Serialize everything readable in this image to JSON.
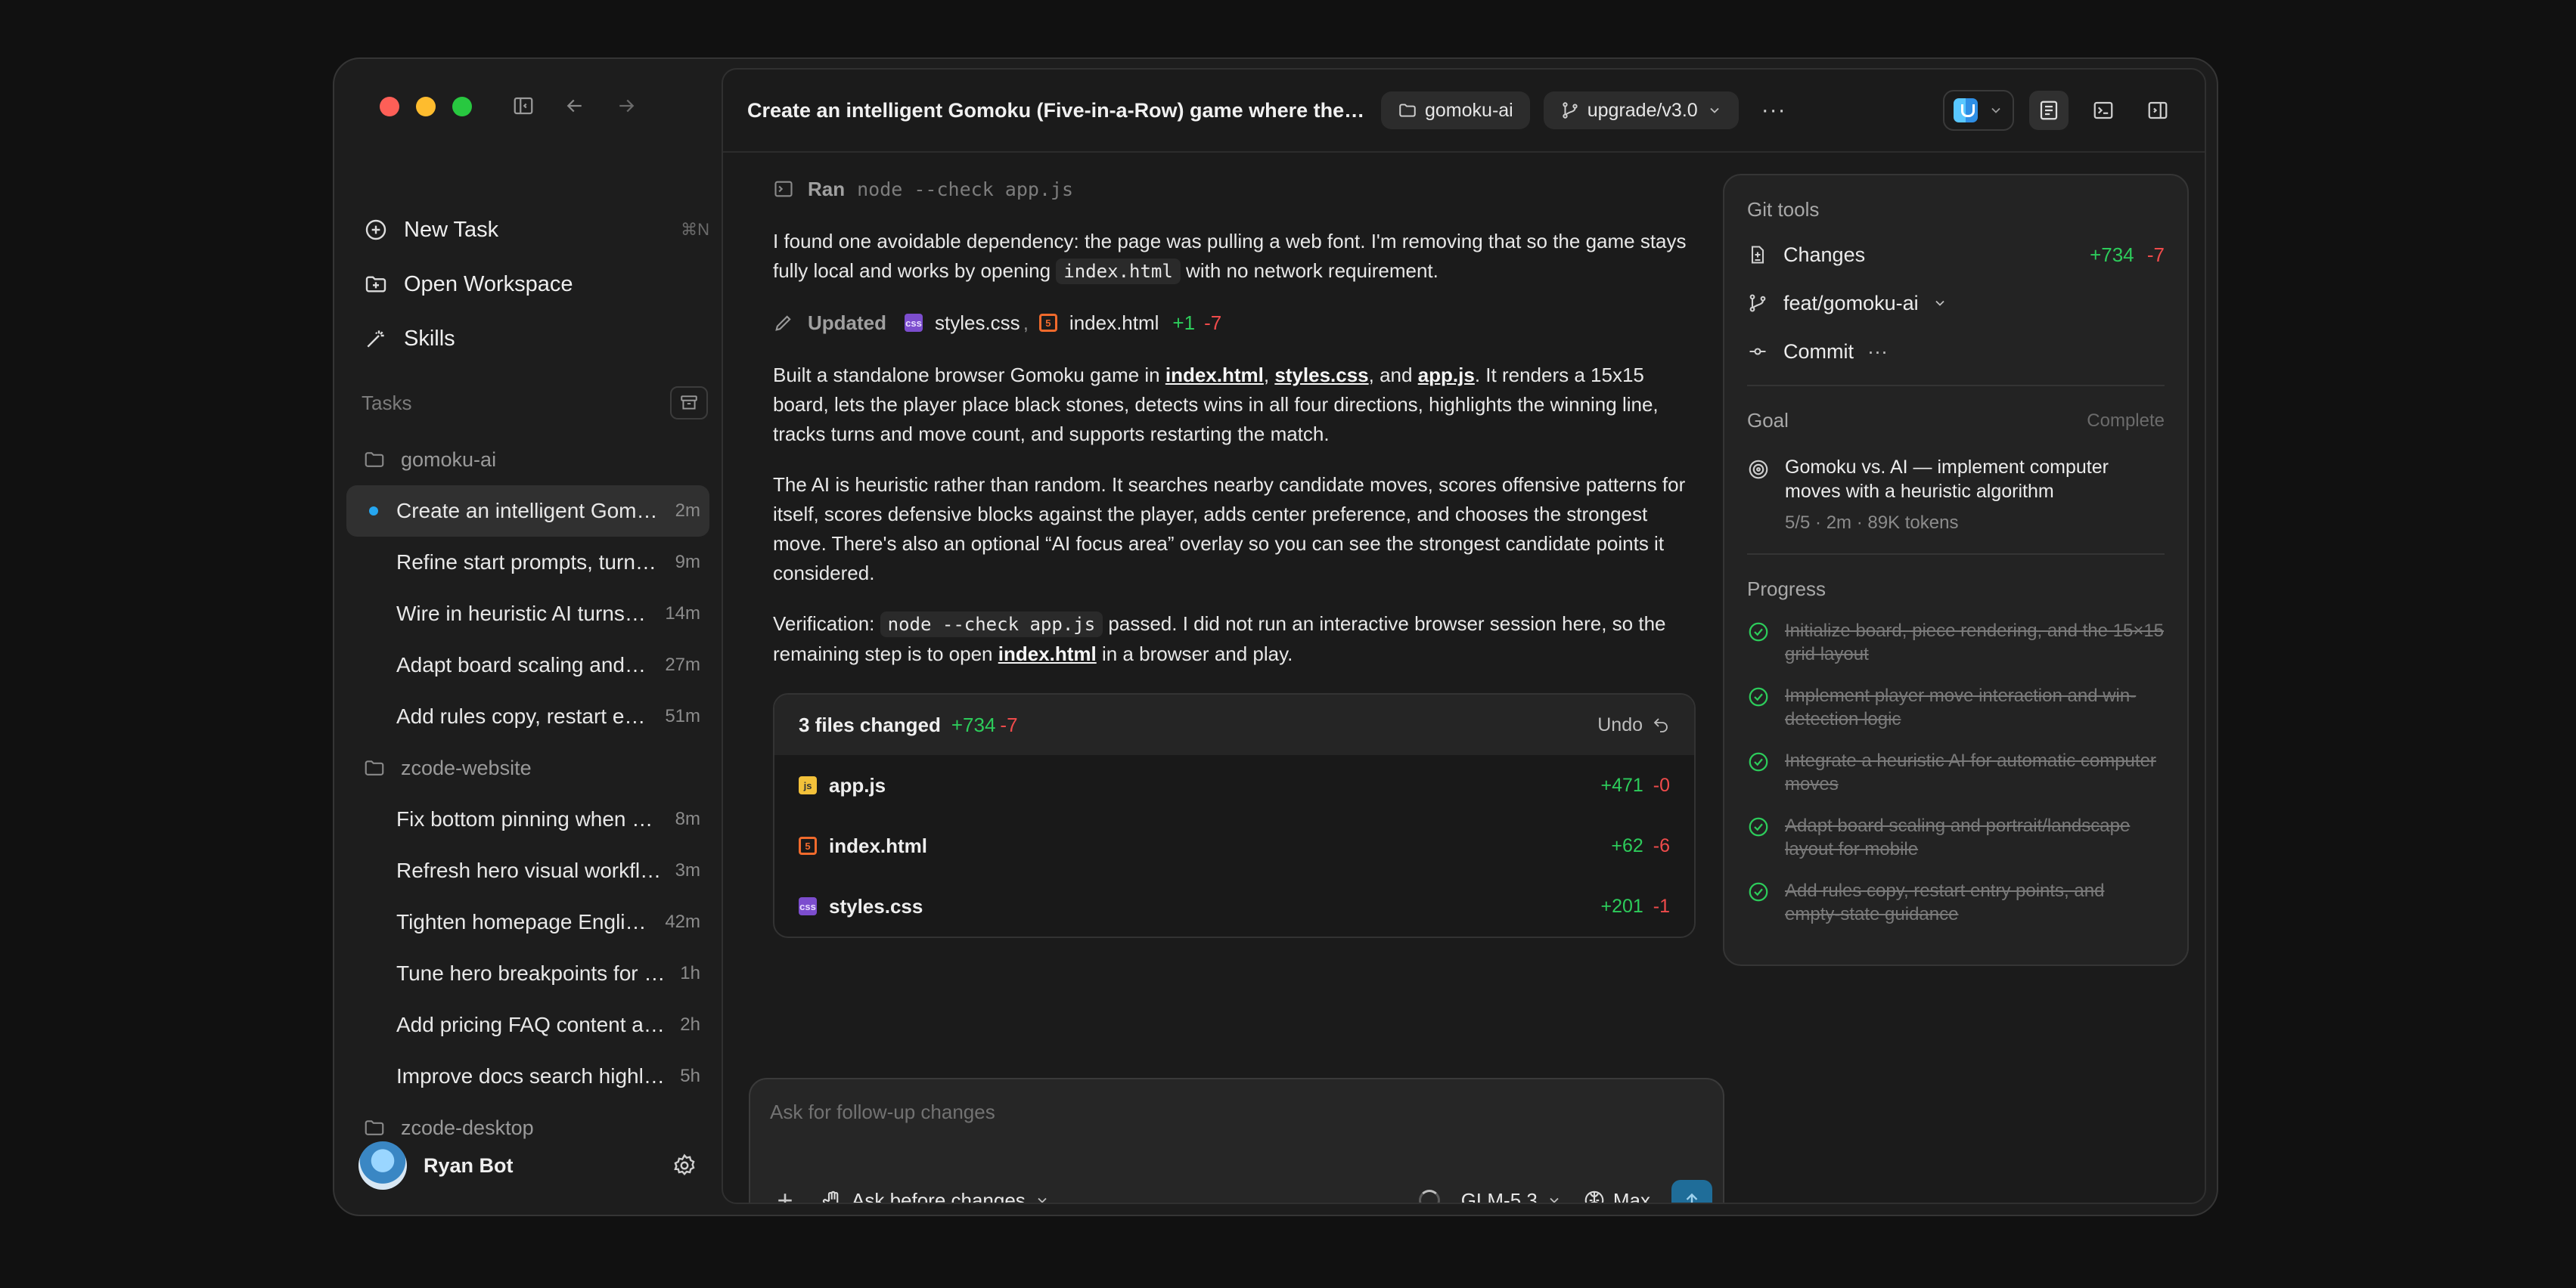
{
  "sidebar": {
    "menu": [
      {
        "label": "New Task",
        "shortcut": "⌘N"
      },
      {
        "label": "Open Workspace",
        "shortcut": ""
      },
      {
        "label": "Skills",
        "shortcut": ""
      }
    ],
    "tasks_label": "Tasks",
    "groups": [
      {
        "folder": "gomoku-ai",
        "tasks": [
          {
            "label": "Create an intelligent Gomoku (Five-in-a-Row) game where the AI plays",
            "time": "2m",
            "active": true
          },
          {
            "label": "Refine start prompts, turn indicators",
            "time": "9m"
          },
          {
            "label": "Wire in heuristic AI turns and scoring",
            "time": "14m"
          },
          {
            "label": "Adapt board scaling and layout",
            "time": "27m"
          },
          {
            "label": "Add rules copy, restart entry points",
            "time": "51m"
          }
        ]
      },
      {
        "folder": "zcode-website",
        "tasks": [
          {
            "label": "Fix bottom pinning when scrolling",
            "time": "8m"
          },
          {
            "label": "Refresh hero visual workflow",
            "time": "3m"
          },
          {
            "label": "Tighten homepage English copy",
            "time": "42m"
          },
          {
            "label": "Tune hero breakpoints for tablets",
            "time": "1h"
          },
          {
            "label": "Add pricing FAQ content and links",
            "time": "2h"
          },
          {
            "label": "Improve docs search highlighting",
            "time": "5h"
          }
        ]
      },
      {
        "folder": "zcode-desktop",
        "tasks": []
      }
    ],
    "user": {
      "name": "Ryan Bot"
    }
  },
  "topbar": {
    "title": "Create an intelligent Gomoku (Five-in-a-Row) game where the AI plays against the player",
    "repo": "gomoku-ai",
    "branch": "upgrade/v3.0",
    "more": "···"
  },
  "conversation": {
    "ran_label": "Ran",
    "ran_cmd": "node --check app.js",
    "p1": [
      "I found one avoidable dependency: the page was pulling a web font. I'm removing that so the game stays fully local and works by opening ",
      "index.html",
      " with no network requirement."
    ],
    "updated_label": "Updated",
    "updated_file1": "styles.css",
    "updated_sep": ",",
    "updated_file2": "index.html",
    "updated_add": "+1",
    "updated_del": "-7",
    "p2": [
      "Built a standalone browser Gomoku game in ",
      "index.html",
      ", ",
      "styles.css",
      ", and ",
      "app.js",
      ". It renders a 15x15 board, lets the player place black stones, detects wins in all four directions, highlights the winning line, tracks turns and move count, and supports restarting the match."
    ],
    "p3": "The AI is heuristic rather than random. It searches nearby candidate moves, scores offensive patterns for itself, scores defensive blocks against the player, adds center preference, and chooses the strongest move. There's also an optional “AI focus area” overlay so you can see the strongest candidate points it considered.",
    "p4": [
      "Verification: ",
      "node --check app.js",
      " passed. I did not run an interactive browser session here, so the remaining step is to open ",
      "index.html",
      " in a browser and play."
    ]
  },
  "files_changed": {
    "title": "3 files changed",
    "add": "+734",
    "del": "-7",
    "undo": "Undo",
    "files": [
      {
        "name": "app.js",
        "kind": "js",
        "add": "+471",
        "del": "-0"
      },
      {
        "name": "index.html",
        "kind": "html",
        "add": "+62",
        "del": "-6"
      },
      {
        "name": "styles.css",
        "kind": "css",
        "add": "+201",
        "del": "-1"
      }
    ]
  },
  "git": {
    "title": "Git tools",
    "changes_label": "Changes",
    "changes_add": "+734",
    "changes_del": "-7",
    "branch": "feat/gomoku-ai",
    "commit": "Commit",
    "commit_more": "···",
    "goal_label": "Goal",
    "goal_status": "Complete",
    "goal_text": "Gomoku vs. AI — implement computer moves with a heuristic algorithm",
    "goal_meta": "5/5 · 2m · 89K tokens",
    "progress_label": "Progress",
    "progress": [
      "Initialize board, piece rendering, and the 15×15 grid layout",
      "Implement player move interaction and win-detection logic",
      "Integrate a heuristic AI for automatic computer moves",
      "Adapt board scaling and portrait/landscape layout for mobile",
      "Add rules copy, restart entry points, and empty-state guidance"
    ]
  },
  "composer": {
    "placeholder": "Ask for follow-up changes",
    "plus": "+",
    "mode": "Ask before changes",
    "model": "GLM-5.3",
    "effort": "Max"
  },
  "colors": {
    "add": "#2dcc5b",
    "del": "#ef4b4b",
    "accent": "#25a6f0",
    "send": "#1f6d99"
  }
}
